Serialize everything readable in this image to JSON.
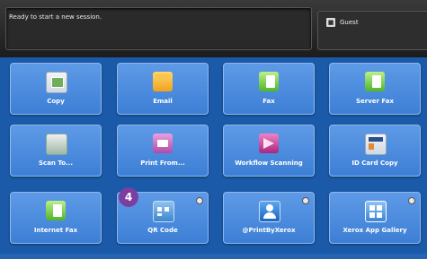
{
  "status": {
    "text": "Ready to start a new session."
  },
  "user": {
    "name": "Guest"
  },
  "tiles": [
    {
      "label": "Copy"
    },
    {
      "label": "Email"
    },
    {
      "label": "Fax"
    },
    {
      "label": "Server Fax"
    },
    {
      "label": "Scan To..."
    },
    {
      "label": "Print From..."
    },
    {
      "label": "Workflow Scanning"
    },
    {
      "label": "ID Card Copy"
    },
    {
      "label": "Internet Fax"
    },
    {
      "label": "QR Code"
    },
    {
      "label": "@PrintByXerox"
    },
    {
      "label": "Xerox App Gallery"
    }
  ],
  "annotation": {
    "badge": "4"
  }
}
